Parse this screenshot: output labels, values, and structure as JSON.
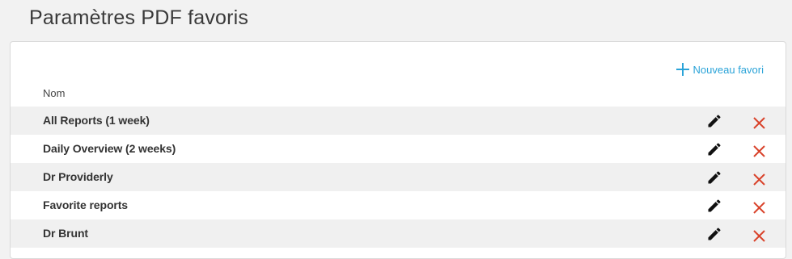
{
  "page": {
    "title": "Paramètres PDF favoris"
  },
  "toolbar": {
    "new_favorite_label": "Nouveau favori"
  },
  "table": {
    "column_header": "Nom",
    "rows": [
      {
        "name": "All Reports (1 week)"
      },
      {
        "name": "Daily Overview (2 weeks)"
      },
      {
        "name": "Dr Providerly"
      },
      {
        "name": "Favorite reports"
      },
      {
        "name": "Dr Brunt"
      }
    ]
  },
  "icons": {
    "add": "plus-icon",
    "edit": "pencil-icon",
    "delete": "close-icon"
  },
  "colors": {
    "accent": "#2aa3d8",
    "delete": "#d9432b",
    "row_stripe": "#f0f0f0"
  }
}
